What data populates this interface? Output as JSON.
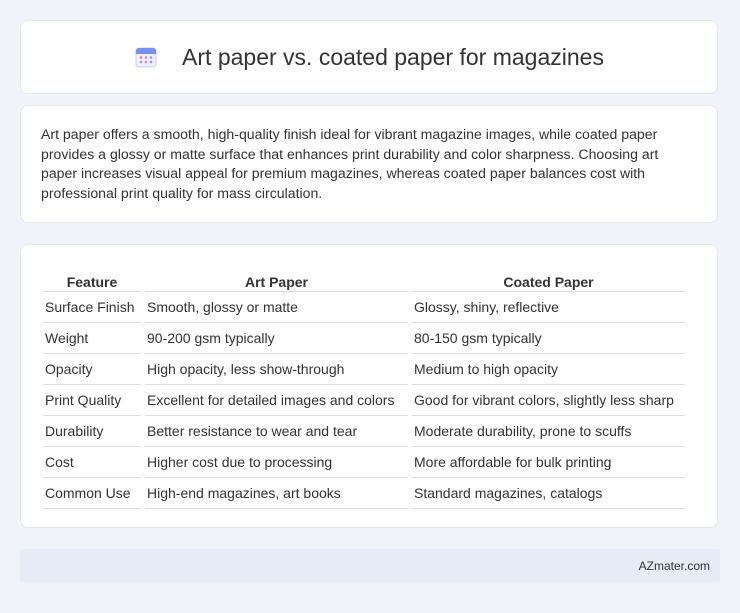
{
  "header": {
    "title": "Art paper vs. coated paper for magazines",
    "icon": "calendar-icon"
  },
  "description": "Art paper offers a smooth, high-quality finish ideal for vibrant magazine images, while coated paper provides a glossy or matte surface that enhances print durability and color sharpness. Choosing art paper increases visual appeal for premium magazines, whereas coated paper balances cost with professional print quality for mass circulation.",
  "table": {
    "headers": [
      "Feature",
      "Art Paper",
      "Coated Paper"
    ],
    "rows": [
      [
        "Surface Finish",
        "Smooth, glossy or matte",
        "Glossy, shiny, reflective"
      ],
      [
        "Weight",
        "90-200 gsm typically",
        "80-150 gsm typically"
      ],
      [
        "Opacity",
        "High opacity, less show-through",
        "Medium to high opacity"
      ],
      [
        "Print Quality",
        "Excellent for detailed images and colors",
        "Good for vibrant colors, slightly less sharp"
      ],
      [
        "Durability",
        "Better resistance to wear and tear",
        "Moderate durability, prone to scuffs"
      ],
      [
        "Cost",
        "Higher cost due to processing",
        "More affordable for bulk printing"
      ],
      [
        "Common Use",
        "High-end magazines, art books",
        "Standard magazines, catalogs"
      ]
    ]
  },
  "footer": {
    "brand": "AZmater.com"
  },
  "colors": {
    "background": "#f0f3f8",
    "card": "#ffffff",
    "footer_bar": "#e5ecf7",
    "icon_accent": "#7b8ff0"
  }
}
